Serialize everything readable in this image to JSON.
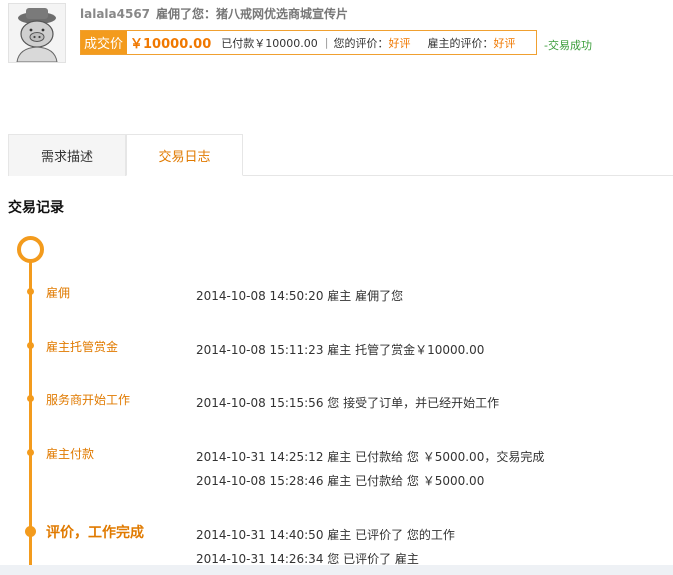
{
  "header": {
    "username": "lalala4567",
    "description": "雇佣了您：猪八戒网优选商城宣传片",
    "deal_label": "成交价",
    "deal_price": "￥10000.00",
    "paid_text": "已付款￥10000.00",
    "separator": "|",
    "my_rating_label": "您的评价：",
    "my_rating_value": "好评",
    "employer_rating_label": "雇主的评价：",
    "employer_rating_value": "好评",
    "status": "-交易成功"
  },
  "tabs": [
    {
      "label": "需求描述"
    },
    {
      "label": "交易日志"
    }
  ],
  "section_title": "交易记录",
  "timeline": [
    {
      "stage": "雇佣",
      "logs": [
        "2014-10-08 14:50:20 雇主 雇佣了您"
      ]
    },
    {
      "stage": "雇主托管赏金",
      "logs": [
        "2014-10-08 15:11:23 雇主 托管了赏金￥10000.00"
      ]
    },
    {
      "stage": "服务商开始工作",
      "logs": [
        "2014-10-08 15:15:56 您 接受了订单，并已经开始工作"
      ]
    },
    {
      "stage": "雇主付款",
      "logs": [
        "2014-10-31 14:25:12 雇主 已付款给 您 ￥5000.00，交易完成",
        "2014-10-08 15:28:46 雇主 已付款给 您 ￥5000.00"
      ]
    },
    {
      "stage": "评价，工作完成",
      "logs": [
        "2014-10-31 14:40:50 雇主  已评价了 您的工作",
        "2014-10-31 14:26:34 您  已评价了 雇主"
      ]
    }
  ],
  "colors": {
    "accent": "#f39b1d",
    "accent_text": "#e07a00",
    "success": "#3a9d3a"
  }
}
